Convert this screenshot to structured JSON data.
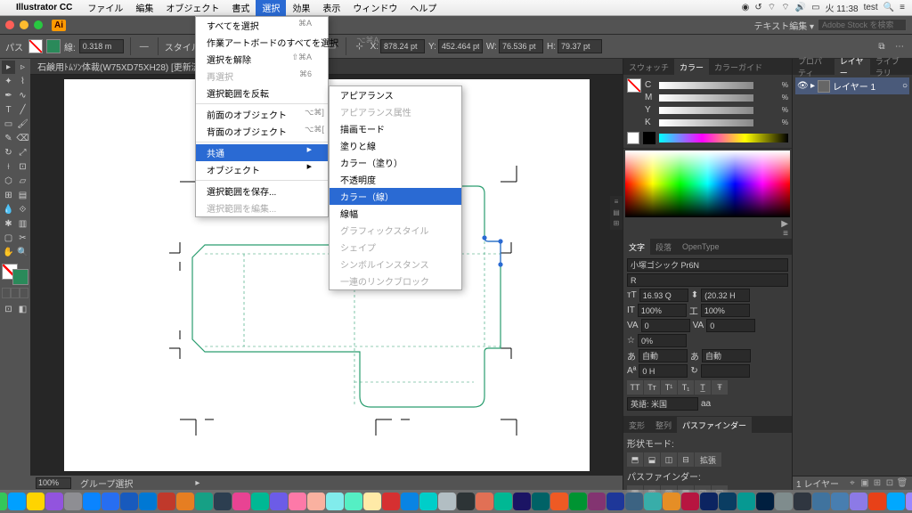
{
  "sys": {
    "appname": "Illustrator CC",
    "menus": [
      "ファイル",
      "編集",
      "オブジェクト",
      "書式",
      "選択",
      "効果",
      "表示",
      "ウィンドウ",
      "ヘルプ"
    ],
    "active_menu_index": 4,
    "clock": "火 11:38",
    "user": "test"
  },
  "dropdown1": {
    "items": [
      {
        "label": "すべてを選択",
        "sc": "⌘A"
      },
      {
        "label": "作業アートボードのすべてを選択",
        "sc": "⌥⌘A"
      },
      {
        "label": "選択を解除",
        "sc": "⇧⌘A"
      },
      {
        "label": "再選択",
        "sc": "⌘6",
        "dis": true
      },
      {
        "label": "選択範囲を反転"
      },
      {
        "sep": true
      },
      {
        "label": "前面のオブジェクト",
        "sc": "⌥⌘]"
      },
      {
        "label": "背面のオブジェクト",
        "sc": "⌥⌘["
      },
      {
        "sep": true
      },
      {
        "label": "共通",
        "arrow": true,
        "hov": true
      },
      {
        "label": "オブジェクト",
        "arrow": true
      },
      {
        "sep": true
      },
      {
        "label": "選択範囲を保存..."
      },
      {
        "label": "選択範囲を編集...",
        "dis": true
      }
    ]
  },
  "dropdown2": {
    "items": [
      {
        "label": "アピアランス"
      },
      {
        "label": "アピアランス属性",
        "dis": true
      },
      {
        "label": "描画モード"
      },
      {
        "label": "塗りと線"
      },
      {
        "label": "カラー（塗り）"
      },
      {
        "label": "不透明度"
      },
      {
        "label": "カラー（線）",
        "hov": true
      },
      {
        "label": "線幅"
      },
      {
        "label": "グラフィックスタイル",
        "dis": true
      },
      {
        "label": "シェイプ",
        "dis": true
      },
      {
        "label": "シンボルインスタンス",
        "dis": true
      },
      {
        "label": "一連のリンクブロック",
        "dis": true
      }
    ]
  },
  "appbar": {
    "essentials": "テキスト編集 ▾",
    "search_ph": "Adobe Stock を検索"
  },
  "ctrl": {
    "label_path": "パス",
    "stroke_w": "0.318 m",
    "style_label": "スタイル:",
    "x_label": "X:",
    "x": "878.24 pt",
    "y_label": "Y:",
    "y": "452.464 pt",
    "w_label": "W:",
    "w": "76.536 pt",
    "h_label": "H:",
    "h": "79.37 pt"
  },
  "doc": {
    "tab": "石鹸用ﾄﾑｿﾝ体裁(W75XD75XH28) [更新済み].ai* ..."
  },
  "status": {
    "zoom": "100%",
    "tool": "グループ選択"
  },
  "rpanel": {
    "tabs1": [
      "スウォッチ",
      "カラー",
      "カラーガイド"
    ],
    "active1": 1,
    "cmyk": [
      "C",
      "M",
      "Y",
      "K"
    ],
    "tabs2": [
      "文字",
      "段落",
      "OpenType"
    ],
    "active2": 0,
    "font": "小塚ゴシック Pr6N",
    "weight": "R",
    "size": "16.93 Q",
    "leading": "(20.32 H",
    "track1": "100%",
    "track2": "100%",
    "kern": "0",
    "va": "0",
    "opac": "0%",
    "auto1": "自動",
    "auto2": "自動",
    "oh": "0 H",
    "lang": "英語: 米国",
    "tabs3": [
      "変形",
      "整列",
      "パスファインダー"
    ],
    "active3": 2,
    "shape_mode": "形状モード:",
    "pathfinder": "パスファインダー:"
  },
  "rpanel2": {
    "tabs": [
      "プロパティ",
      "レイヤー",
      "ライブラリ"
    ],
    "active": 1,
    "layer": "レイヤー 1",
    "status": "1 レイヤー"
  },
  "dock_colors": [
    "#1e6fd9",
    "#ff3b30",
    "#34c759",
    "#00a0ff",
    "#ffd400",
    "#9254de",
    "#8e8e93",
    "#0a84ff",
    "#276ef1",
    "#185abd",
    "#0078d4",
    "#c0392b",
    "#e67e22",
    "#16a085",
    "#2c3e50",
    "#e84393",
    "#00b894",
    "#6c5ce7",
    "#fd79a8",
    "#fab1a0",
    "#81ecec",
    "#55efc4",
    "#ffeaa7",
    "#d63031",
    "#0984e3",
    "#00cec9",
    "#b2bec3",
    "#2d3436",
    "#e17055",
    "#00b894",
    "#1b1464",
    "#006266",
    "#EE5A24",
    "#009432",
    "#833471",
    "#1e3799",
    "#3c6382",
    "#38ada9",
    "#e58e26",
    "#b71540",
    "#0c2461",
    "#0a3d62",
    "#079992",
    "#001f3f",
    "#7f8c8d",
    "#2f3640",
    "#40739e",
    "#487eb0",
    "#8c7ae6",
    "#e84118",
    "#00a8ff",
    "#9c88ff",
    "#fbc531",
    "#4cd137"
  ]
}
